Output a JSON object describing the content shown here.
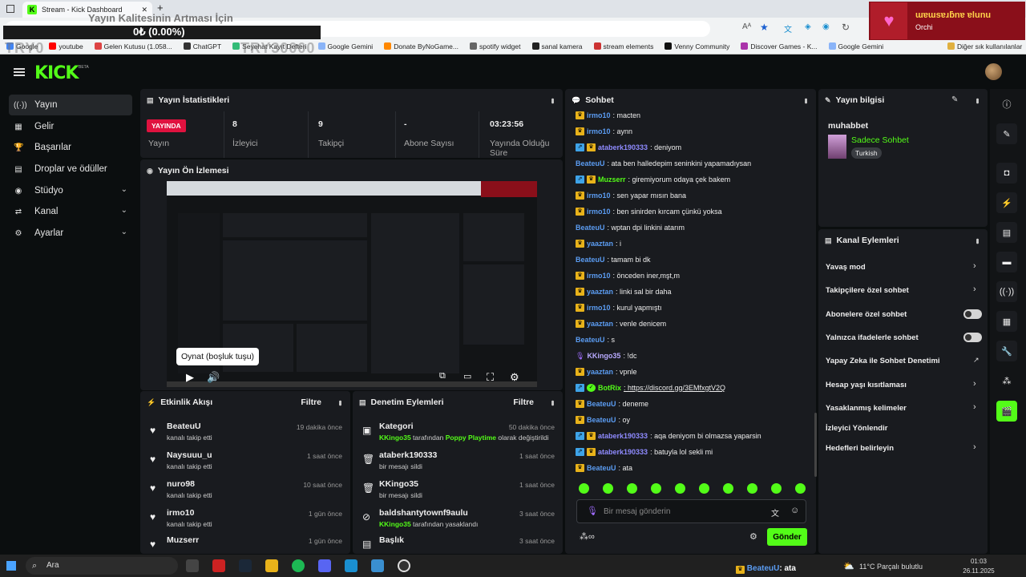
{
  "browser": {
    "tab_title": "Stream - Kick Dashboard",
    "new_tab": "+",
    "bookmarks": [
      "Google",
      "youtube",
      "Gelen Kutusu (1.058...",
      "ChatGPT",
      "Seyehat Kayıt Defteri",
      "Google Gemini",
      "Donate ByNoGame...",
      "spotify widget",
      "sanal kamera",
      "stream elements",
      "Venny Community",
      "Discover Games - K...",
      "Google Gemini"
    ],
    "other_bookmarks": "Diğer sık kullanılanlar"
  },
  "overlay": {
    "goal_title": "Yayın Kalitesinin Artması İçin",
    "goal_value": "0₺ (0.00%)",
    "try_left": "TRY0",
    "try_right": "TRY30000",
    "alert_title": "ɯɐɯsɐɹƃnɐ ɐlunu",
    "alert_user": "Orchi"
  },
  "app": {
    "logo": "KICK",
    "beta": "BETA"
  },
  "sidebar": [
    {
      "label": "Yayın",
      "icon": "((·))",
      "active": true
    },
    {
      "label": "Gelir",
      "icon": "▦"
    },
    {
      "label": "Başarılar",
      "icon": "🏆"
    },
    {
      "label": "Droplar ve ödüller",
      "icon": "▤"
    },
    {
      "label": "Stüdyo",
      "icon": "◉",
      "chev": "⌄"
    },
    {
      "label": "Kanal",
      "icon": "⇄",
      "chev": "⌄"
    },
    {
      "label": "Ayarlar",
      "icon": "⚙",
      "chev": "⌄"
    }
  ],
  "stats": {
    "title": "Yayın İstatistikleri",
    "live_badge": "YAYINDA",
    "live_label": "Yayın",
    "items": [
      {
        "value": "8",
        "label": "İzleyici"
      },
      {
        "value": "9",
        "label": "Takipçi"
      },
      {
        "value": "-",
        "label": "Abone Sayısı"
      },
      {
        "value": "03:23:56",
        "label": "Yayında Olduğu Süre"
      }
    ]
  },
  "preview": {
    "title": "Yayın Ön İzlemesi",
    "tooltip": "Oynat (boşluk tuşu)"
  },
  "activity": {
    "title": "Etkinlik Akışı",
    "filter": "Filtre",
    "items": [
      {
        "name": "BeateuU",
        "sub": "kanalı takip etti",
        "time": "19 dakika önce"
      },
      {
        "name": "Naysuuu_u",
        "sub": "kanalı takip etti",
        "time": "1 saat önce"
      },
      {
        "name": "nuro98",
        "sub": "kanalı takip etti",
        "time": "10 saat önce"
      },
      {
        "name": "irmo10",
        "sub": "kanalı takip etti",
        "time": "1 gün önce"
      },
      {
        "name": "Muzserr",
        "sub": "",
        "time": "1 gün önce"
      }
    ]
  },
  "moderation": {
    "title": "Denetim Eylemleri",
    "filter": "Filtre",
    "items": [
      {
        "name": "Kategori",
        "actor": "KKingo35",
        "mid": " tarafından ",
        "target": "Poppy Playtime",
        "rest": " olarak değiştirildi",
        "time": "50 dakika önce"
      },
      {
        "name": "ataberk190333",
        "sub": "bir mesajı sildi",
        "time": "1 saat önce"
      },
      {
        "name": "KKingo35",
        "sub": "bir mesajı sildi",
        "time": "1 saat önce"
      },
      {
        "name": "baldshantytownf9aulu",
        "actor": "KKingo35",
        "mid": " tarafından yasaklandı",
        "target": "",
        "rest": "",
        "time": "3 saat önce"
      },
      {
        "name": "Başlık",
        "sub": "",
        "time": "3 saat önce"
      }
    ]
  },
  "chat": {
    "title": "Sohbet",
    "placeholder": "Bir mesaj gönderin",
    "send": "Gönder",
    "messages": [
      {
        "badges": [
          "crown"
        ],
        "user": "irmo10",
        "cls": "u-blue",
        "text": ": macten"
      },
      {
        "badges": [
          "crown"
        ],
        "user": "irmo10",
        "cls": "u-blue",
        "text": ": aynn"
      },
      {
        "badges": [
          "boost",
          "crown"
        ],
        "user": "ataberk190333",
        "cls": "u-purp",
        "text": ": deniyom"
      },
      {
        "badges": [],
        "user": "BeateuU",
        "cls": "u-blue",
        "text": ": ata ben halledерim seninkini yapamadıysan"
      },
      {
        "badges": [
          "boost",
          "crown"
        ],
        "user": "Muzserr",
        "cls": "u-green",
        "text": ": giremiyorum odaya çek bakem"
      },
      {
        "badges": [
          "crown"
        ],
        "user": "irmo10",
        "cls": "u-blue",
        "text": ": sen yapar mısın bana"
      },
      {
        "badges": [
          "crown"
        ],
        "user": "irmo10",
        "cls": "u-blue",
        "text": ": ben sinirden kırcam çünkü yoksa"
      },
      {
        "badges": [],
        "user": "BeateuU",
        "cls": "u-blue",
        "text": ": wptan dpi linkini atarım"
      },
      {
        "badges": [
          "crown"
        ],
        "user": "yaaztan",
        "cls": "u-blue",
        "text": ": i"
      },
      {
        "badges": [],
        "user": "BeateuU",
        "cls": "u-blue",
        "text": ": tamam bi dk"
      },
      {
        "badges": [
          "crown"
        ],
        "user": "irmo10",
        "cls": "u-blue",
        "text": ": önceden iner,mşt,m"
      },
      {
        "badges": [
          "crown"
        ],
        "user": "yaaztan",
        "cls": "u-blue",
        "text": ": linki sal bir daha"
      },
      {
        "badges": [
          "crown"
        ],
        "user": "irmo10",
        "cls": "u-blue",
        "text": ": kurul yapmıştı"
      },
      {
        "badges": [
          "crown"
        ],
        "user": "yaaztan",
        "cls": "u-blue",
        "text": ": venle denicem"
      },
      {
        "badges": [],
        "user": "BeateuU",
        "cls": "u-blue",
        "text": ": s"
      },
      {
        "badges": [
          "mic"
        ],
        "user": "KKingo35",
        "cls": "u-lav",
        "text": ": !dc"
      },
      {
        "badges": [
          "crown"
        ],
        "user": "yaaztan",
        "cls": "u-blue",
        "text": ": vpnle"
      },
      {
        "badges": [
          "boost",
          "bot"
        ],
        "user": "BotRix",
        "cls": "u-green",
        "text": ": https://discord.gg/3EMfxgtV2Q"
      },
      {
        "badges": [
          "crown"
        ],
        "user": "BeateuU",
        "cls": "u-blue",
        "text": ": deneme"
      },
      {
        "badges": [
          "crown"
        ],
        "user": "BeateuU",
        "cls": "u-blue",
        "text": ": oy"
      },
      {
        "badges": [
          "boost",
          "crown"
        ],
        "user": "ataberk190333",
        "cls": "u-purp",
        "text": ": aqa deniyom bi olmazsa yaparsin"
      },
      {
        "badges": [
          "boost",
          "crown"
        ],
        "user": "ataberk190333",
        "cls": "u-purp",
        "text": ": batuyla lol sekli mi"
      },
      {
        "badges": [
          "crown"
        ],
        "user": "BeateuU",
        "cls": "u-blue",
        "text": ": ata"
      }
    ]
  },
  "stream_info": {
    "title": "Yayın bilgisi",
    "stream_title": "muhabbet",
    "category": "Sadece Sohbet",
    "tag": "Turkish"
  },
  "channel_actions": {
    "title": "Kanal Eylemleri",
    "items": [
      {
        "label": "Yavaş mod",
        "kind": "chev"
      },
      {
        "label": "Takipçilere özel sohbet",
        "kind": "chev"
      },
      {
        "label": "Abonelere özel sohbet",
        "kind": "toggle"
      },
      {
        "label": "Yalnızca ifadelerle sohbet",
        "kind": "toggle"
      },
      {
        "label": "Yapay Zeka ile Sohbet Denetimi",
        "kind": "ext"
      },
      {
        "label": "Hesap yaşı kısıtlaması",
        "kind": "chev"
      },
      {
        "label": "Yasaklanmış kelimeler",
        "kind": "chev"
      },
      {
        "label": "İzleyici Yönlendir",
        "kind": "none"
      },
      {
        "label": "Hedefleri belirleyin",
        "kind": "chev"
      }
    ]
  },
  "taskbar": {
    "search": "Ara",
    "weather": "11°C  Parçalı bulutlu",
    "time": "01:03",
    "date": "26.11.2025",
    "now_playing_user": "BeateuU",
    "now_playing_text": ": ata"
  }
}
